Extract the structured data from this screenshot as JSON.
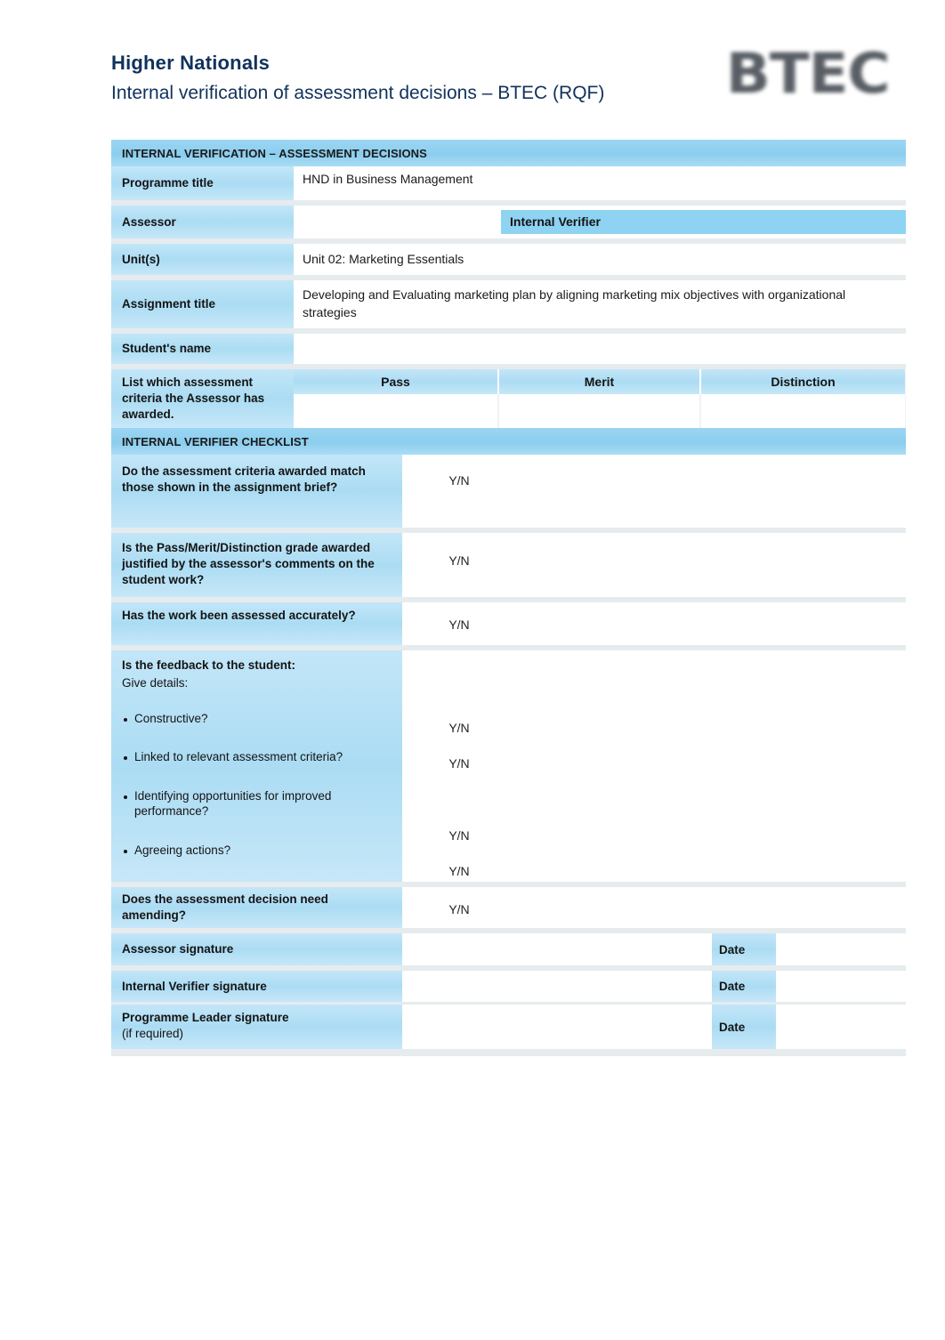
{
  "header": {
    "title_main": "Higher Nationals",
    "title_sub": "Internal verification of assessment decisions – BTEC (RQF)",
    "logo_text": "BTEC"
  },
  "section_banners": {
    "assessment_decisions": "INTERNAL VERIFICATION – ASSESSMENT DECISIONS",
    "verifier_checklist": "INTERNAL VERIFIER CHECKLIST"
  },
  "assessment_decisions": {
    "programme_title_label": "Programme title",
    "programme_title_value": "HND in Business Management",
    "assessor_label": "Assessor",
    "assessor_value": "",
    "internal_verifier_label": "Internal  Verifier",
    "internal_verifier_value": "",
    "units_label": "Unit(s)",
    "units_value": "Unit 02: Marketing Essentials",
    "assignment_title_label": "Assignment title",
    "assignment_title_value": "Developing and Evaluating marketing plan by aligning marketing mix objectives with organizational strategies",
    "student_name_label": "Student's name",
    "student_name_value": "",
    "criteria_label": "List which assessment criteria the Assessor has awarded.",
    "criteria_columns": [
      {
        "name": "Pass",
        "value": ""
      },
      {
        "name": "Merit",
        "value": ""
      },
      {
        "name": "Distinction",
        "value": ""
      }
    ]
  },
  "checklist": {
    "yn_token": "Y/N",
    "items": [
      {
        "question": "Do the assessment criteria awarded match those shown in the assignment brief?",
        "answer": "Y/N",
        "comment": ""
      },
      {
        "question": "Is the Pass/Merit/Distinction grade awarded justified by the assessor's comments on the student work?",
        "answer": "Y/N",
        "comment": ""
      },
      {
        "question": "Has the work been assessed accurately?",
        "answer": "Y/N",
        "comment": ""
      }
    ],
    "feedback": {
      "heading": "Is the feedback to the student:",
      "subheading": "Give details:",
      "bullets": [
        {
          "text": "Constructive?",
          "answer": "Y/N"
        },
        {
          "text": "Linked to relevant assessment criteria?",
          "answer": "Y/N"
        },
        {
          "text": "Identifying opportunities for improved performance?",
          "answer": "Y/N"
        },
        {
          "text": "Agreeing actions?",
          "answer": "Y/N"
        }
      ],
      "comment": ""
    },
    "amend": {
      "question": "Does the assessment decision need amending?",
      "answer": "Y/N",
      "comment": ""
    }
  },
  "signatures": {
    "date_label": "Date",
    "rows": [
      {
        "label": "Assessor signature",
        "signature": "",
        "date": ""
      },
      {
        "label": "Internal Verifier signature",
        "signature": "",
        "date": ""
      },
      {
        "label_bold": "Programme Leader signature",
        "label_plain": " (if required)",
        "signature": "",
        "date": ""
      }
    ]
  },
  "colors": {
    "heading_navy": "#10325c",
    "banner_blue": "#8ccdee",
    "label_blue": "#b7e0f5",
    "chip_blue": "#8ed3f2",
    "page_bg": "#ffffff",
    "gap_gray": "#e6ebee"
  }
}
